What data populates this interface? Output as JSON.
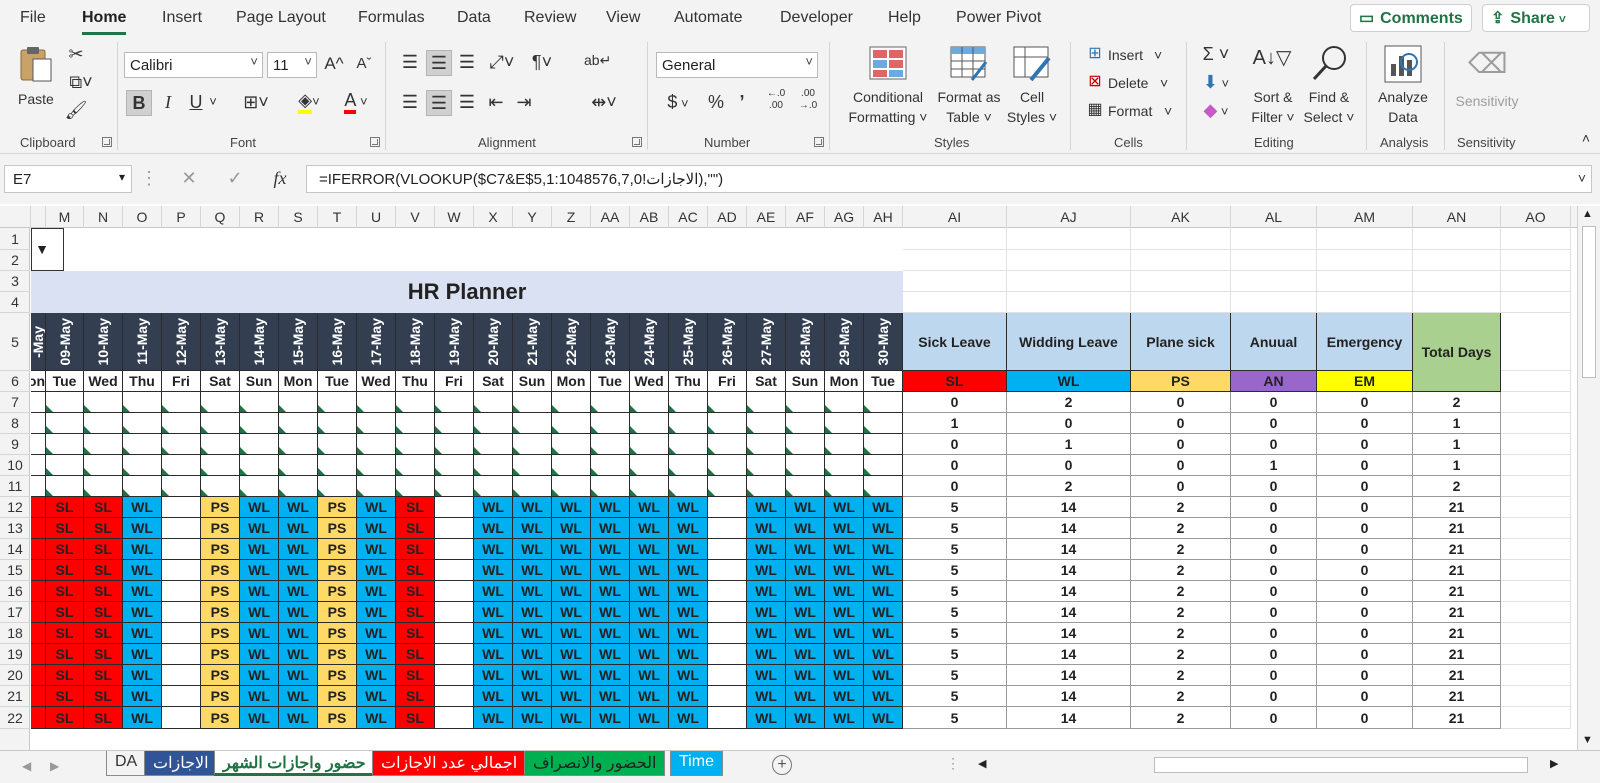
{
  "menu": {
    "tabs": [
      "File",
      "Home",
      "Insert",
      "Page Layout",
      "Formulas",
      "Data",
      "Review",
      "View",
      "Automate",
      "Developer",
      "Help",
      "Power Pivot"
    ],
    "active": "Home",
    "comments_label": "Comments",
    "share_label": "Share"
  },
  "ribbon": {
    "clipboard": {
      "label": "Clipboard",
      "paste": "Paste"
    },
    "font": {
      "label": "Font",
      "name": "Calibri",
      "size": "11",
      "bold": "B",
      "italic": "I",
      "underline": "U",
      "grow": "A^",
      "shrink": "Aˇ",
      "font_color_glyph": "A"
    },
    "alignment": {
      "label": "Alignment"
    },
    "number": {
      "label": "Number",
      "format": "General",
      "currency": "$",
      "percent": "%",
      "comma": "’",
      "inc_decimal": "←.0 .00",
      "dec_decimal": ".00 →.0"
    },
    "styles": {
      "label": "Styles",
      "conditional": [
        "Conditional",
        "Formatting ˅"
      ],
      "format_table": [
        "Format as",
        "Table ˅"
      ],
      "cell_styles": [
        "Cell",
        "Styles ˅"
      ]
    },
    "cells": {
      "label": "Cells",
      "insert": "Insert",
      "delete": "Delete",
      "format": "Format"
    },
    "editing": {
      "label": "Editing",
      "sort": [
        "Sort &",
        "Filter ˅"
      ],
      "find": [
        "Find &",
        "Select ˅"
      ]
    },
    "analysis": {
      "label": "Analysis",
      "analyze": [
        "Analyze",
        "Data"
      ]
    },
    "sensitivity": {
      "label": "Sensitivity",
      "button": "Sensitivity"
    }
  },
  "formula_bar": {
    "name_box": "E7",
    "formula": "=IFERROR(VLOOKUP($C7&E$5,الاجازات!1:1048576,7,0),\"\")"
  },
  "columns": [
    "M",
    "N",
    "O",
    "P",
    "Q",
    "R",
    "S",
    "T",
    "U",
    "V",
    "W",
    "X",
    "Y",
    "Z",
    "AA",
    "AB",
    "AC",
    "AD",
    "AE",
    "AF",
    "AG",
    "AH",
    "AI",
    "AJ",
    "AK",
    "AL",
    "AM",
    "AN",
    "AO"
  ],
  "rows": [
    "1",
    "2",
    "3",
    "4",
    "5",
    "6",
    "7",
    "8",
    "9",
    "10",
    "11",
    "12",
    "13",
    "14",
    "15",
    "16",
    "17",
    "18",
    "19",
    "20",
    "21",
    "22"
  ],
  "sheet": {
    "title": "HR Planner",
    "dates": [
      "09-May",
      "10-May",
      "11-May",
      "12-May",
      "13-May",
      "14-May",
      "15-May",
      "16-May",
      "17-May",
      "18-May",
      "19-May",
      "20-May",
      "21-May",
      "22-May",
      "23-May",
      "24-May",
      "25-May",
      "26-May",
      "27-May",
      "28-May",
      "29-May",
      "30-May"
    ],
    "days": [
      "Tue",
      "Wed",
      "Thu",
      "Fri",
      "Sat",
      "Sun",
      "Mon",
      "Tue",
      "Wed",
      "Thu",
      "Fri",
      "Sat",
      "Sun",
      "Mon",
      "Tue",
      "Wed",
      "Thu",
      "Fri",
      "Sat",
      "Sun",
      "Mon",
      "Tue"
    ],
    "partial_date": "-May",
    "partial_day": "on",
    "leave_codes": [
      "SL",
      "SL",
      "WL",
      "",
      "PS",
      "WL",
      "WL",
      "PS",
      "WL",
      "SL",
      "",
      "WL",
      "WL",
      "WL",
      "WL",
      "WL",
      "WL",
      "",
      "WL",
      "WL",
      "WL",
      "WL"
    ],
    "summary_headers": [
      "Sick Leave",
      "Widding Leave",
      "Plane sick",
      "Anuual",
      "Emergency"
    ],
    "summary_codes": [
      "SL",
      "WL",
      "PS",
      "AN",
      "EM"
    ],
    "total_header": "Total Days",
    "summary_rows": [
      [
        "0",
        "2",
        "0",
        "0",
        "0",
        "2"
      ],
      [
        "1",
        "0",
        "0",
        "0",
        "0",
        "1"
      ],
      [
        "0",
        "1",
        "0",
        "0",
        "0",
        "1"
      ],
      [
        "0",
        "0",
        "0",
        "1",
        "0",
        "1"
      ],
      [
        "0",
        "2",
        "0",
        "0",
        "0",
        "2"
      ],
      [
        "5",
        "14",
        "2",
        "0",
        "0",
        "21"
      ],
      [
        "5",
        "14",
        "2",
        "0",
        "0",
        "21"
      ],
      [
        "5",
        "14",
        "2",
        "0",
        "0",
        "21"
      ],
      [
        "5",
        "14",
        "2",
        "0",
        "0",
        "21"
      ],
      [
        "5",
        "14",
        "2",
        "0",
        "0",
        "21"
      ],
      [
        "5",
        "14",
        "2",
        "0",
        "0",
        "21"
      ],
      [
        "5",
        "14",
        "2",
        "0",
        "0",
        "21"
      ],
      [
        "5",
        "14",
        "2",
        "0",
        "0",
        "21"
      ],
      [
        "5",
        "14",
        "2",
        "0",
        "0",
        "21"
      ],
      [
        "5",
        "14",
        "2",
        "0",
        "0",
        "21"
      ],
      [
        "5",
        "14",
        "2",
        "0",
        "0",
        "21"
      ]
    ]
  },
  "colors": {
    "SL": "#ff0000",
    "WL": "#00b0f0",
    "PS": "#ffd966",
    "AN": "#9966cc",
    "EM": "#ffff00",
    "date_header": "#333f50",
    "summary_header": "#bdd7ee",
    "total_header": "#a9d08e",
    "title_band": "#d9e1f2"
  },
  "sheet_tabs": [
    {
      "label": "DA",
      "bg": "#f3f3f3",
      "fg": "#333333"
    },
    {
      "label": "الاجازات",
      "bg": "#305496",
      "fg": "#ffffff"
    },
    {
      "label": "حضور واجازات الشهر",
      "bg": "#ffffff",
      "fg": "#217346"
    },
    {
      "label": "اجمالي عدد الاجازات",
      "bg": "#ff0000",
      "fg": "#ffffff"
    },
    {
      "label": "الحضور والانصراف",
      "bg": "#00b050",
      "fg": "#222222"
    },
    {
      "label": "Time",
      "bg": "#00b0f0",
      "fg": "#ffffff"
    }
  ]
}
